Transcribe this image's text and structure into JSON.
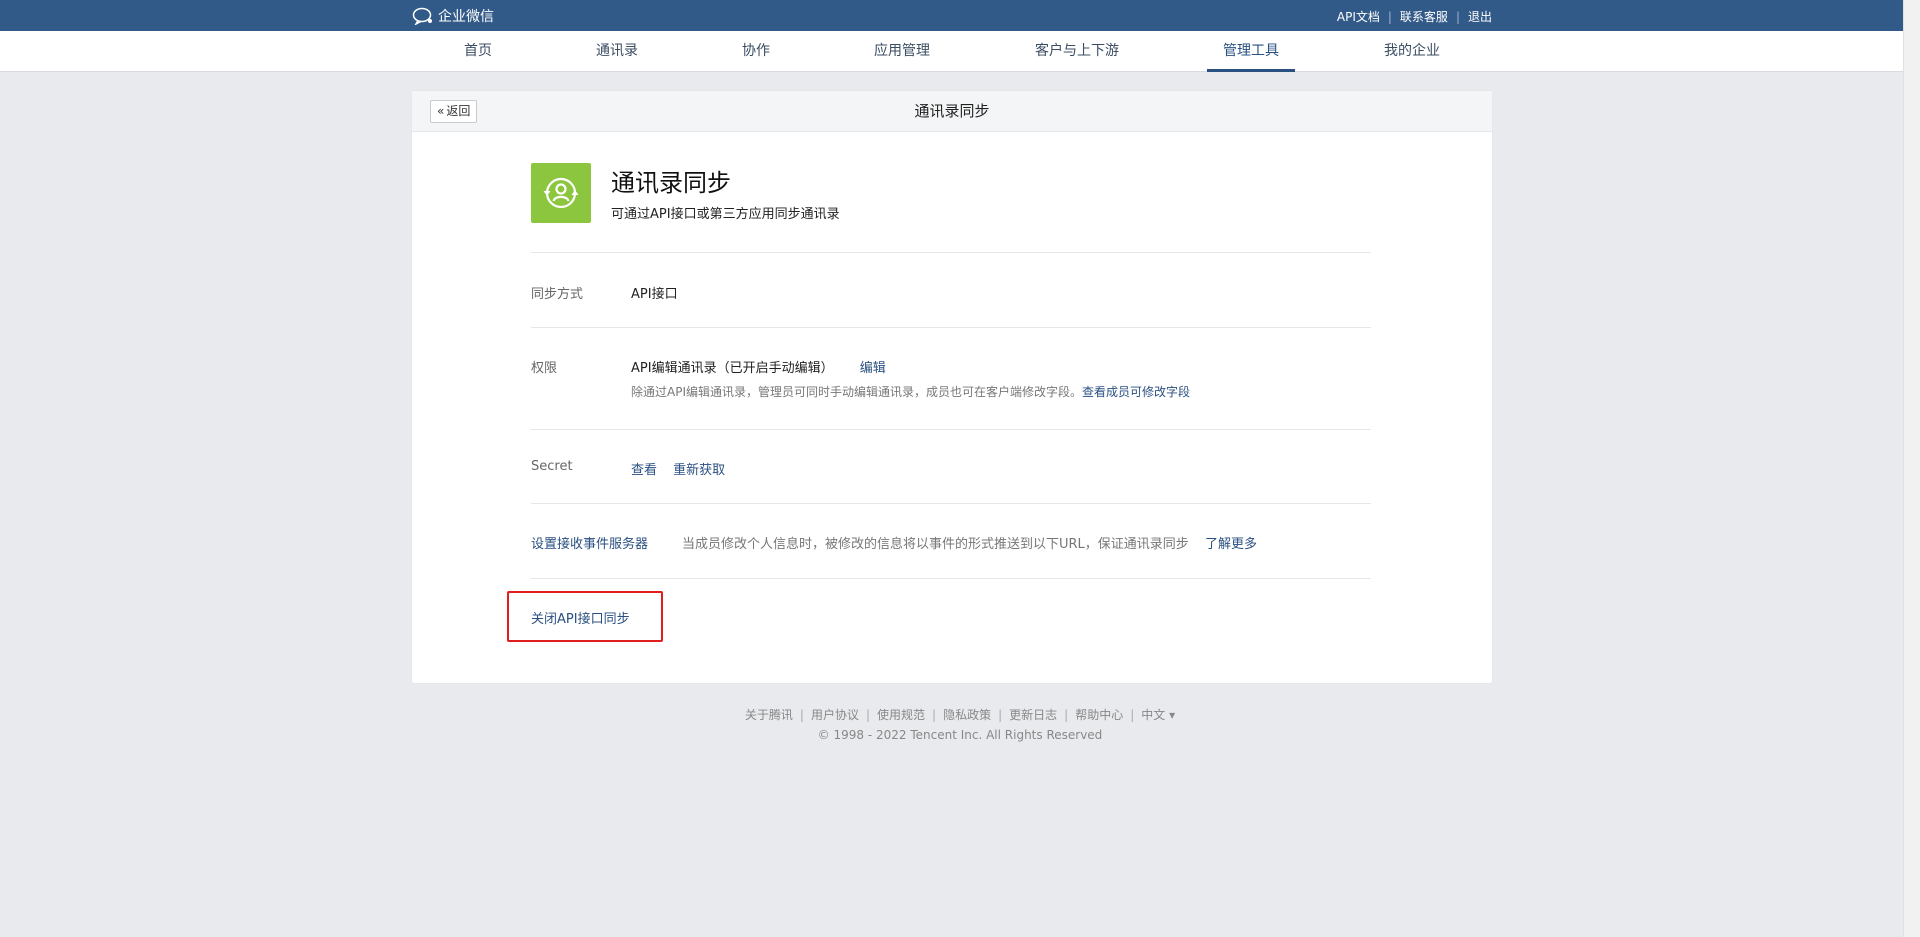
{
  "brand": {
    "logo_text": "企业微信"
  },
  "top_links": [
    "API文档",
    "联系客服",
    "退出"
  ],
  "nav": {
    "items": [
      "首页",
      "通讯录",
      "协作",
      "应用管理",
      "客户与上下游",
      "管理工具",
      "我的企业"
    ],
    "active": "管理工具"
  },
  "panel": {
    "back_label": "返回",
    "title": "通讯录同步",
    "app_name": "通讯录同步",
    "app_desc": "可通过API接口或第三方应用同步通讯录"
  },
  "rows": {
    "sync_method": {
      "label": "同步方式",
      "value": "API接口"
    },
    "permission": {
      "label": "权限",
      "value": "API编辑通讯录（已开启手动编辑）",
      "edit_link": "编辑",
      "hint": "除通过API编辑通讯录，管理员可同时手动编辑通讯录，成员也可在客户端修改字段。",
      "hint_link": "查看成员可修改字段"
    },
    "secret": {
      "label": "Secret",
      "view_link": "查看",
      "refresh_link": "重新获取"
    },
    "event_server": {
      "label": "设置接收事件服务器",
      "desc": "当成员修改个人信息时，被修改的信息将以事件的形式推送到以下URL，保证通讯录同步",
      "more_link": "了解更多"
    },
    "close_api": "关闭API接口同步"
  },
  "footer": {
    "links": [
      "关于腾讯",
      "用户协议",
      "使用规范",
      "隐私政策",
      "更新日志",
      "帮助中心",
      "中文 ▾"
    ],
    "copyright": "© 1998 - 2022 Tencent Inc. All Rights Reserved"
  },
  "colors": {
    "topbar": "#325a88",
    "link": "#2a5081",
    "app_icon": "#8cc63f",
    "highlight": "#e01e1e"
  }
}
